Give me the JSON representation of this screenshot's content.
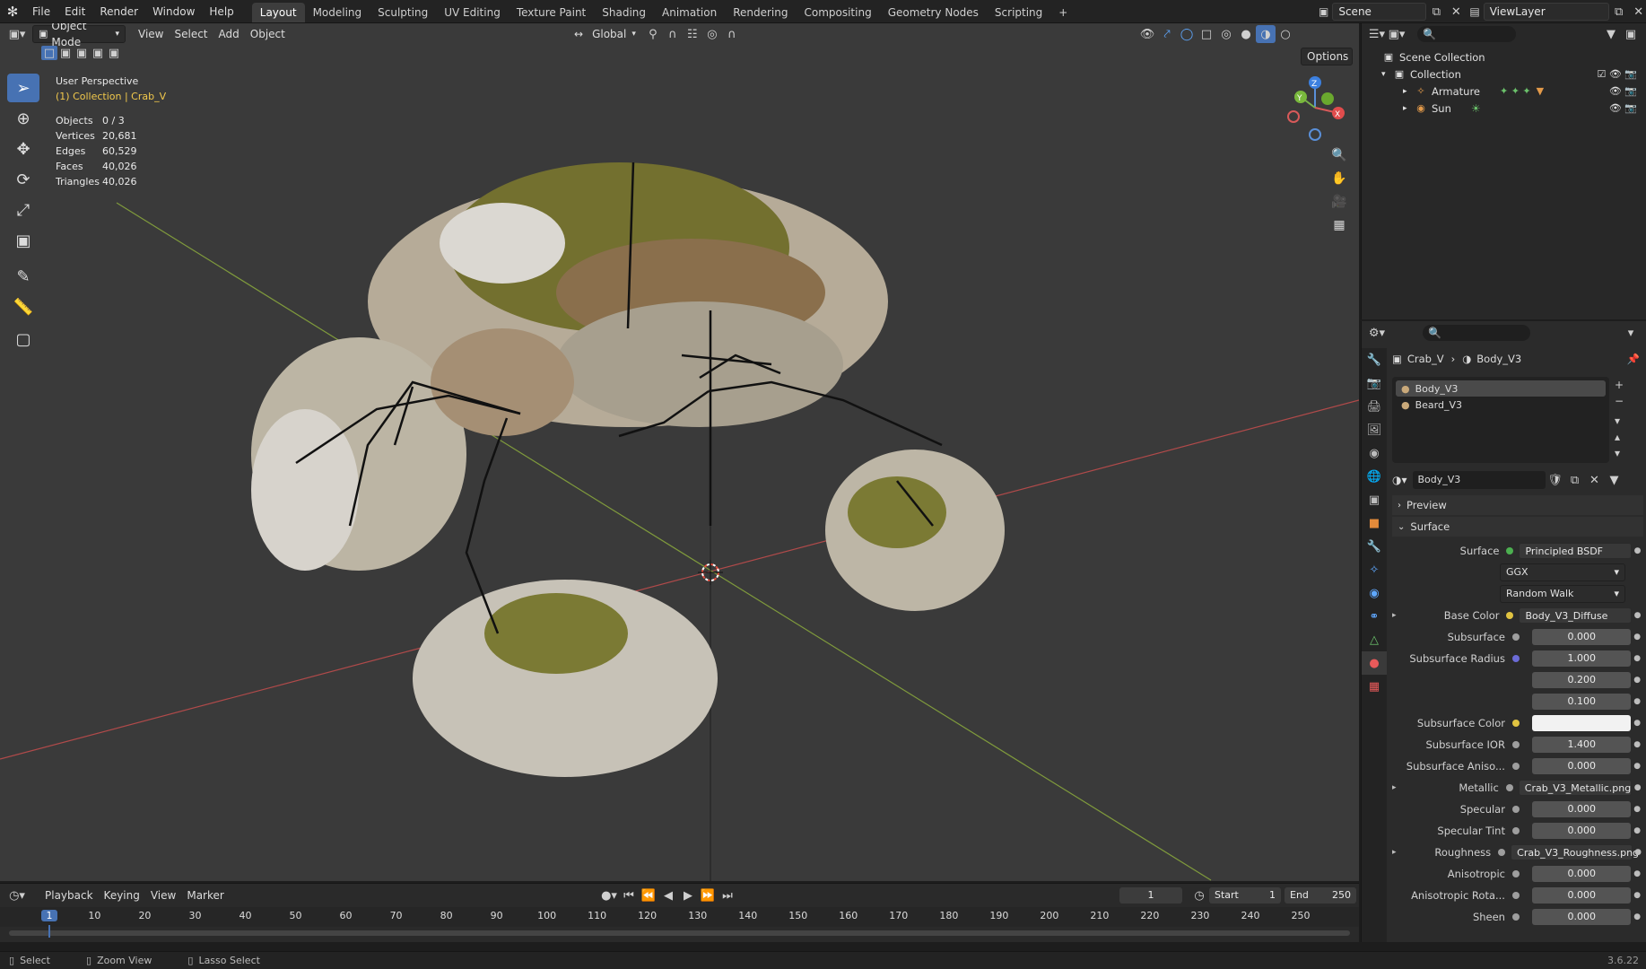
{
  "topbar": {
    "menus": [
      "File",
      "Edit",
      "Render",
      "Window",
      "Help"
    ],
    "workspaces": [
      "Layout",
      "Modeling",
      "Sculpting",
      "UV Editing",
      "Texture Paint",
      "Shading",
      "Animation",
      "Rendering",
      "Compositing",
      "Geometry Nodes",
      "Scripting"
    ],
    "active_workspace": "Layout",
    "add_tab": "+",
    "scene_name": "Scene",
    "view_layer": "ViewLayer"
  },
  "viewport": {
    "mode": "Object Mode",
    "menus": [
      "View",
      "Select",
      "Add",
      "Object"
    ],
    "transform_orientation": "Global",
    "options_label": "Options",
    "perspective": "User Perspective",
    "collection_path": "(1) Collection | Crab_V",
    "stats": [
      {
        "k": "Objects",
        "v": "0 / 3"
      },
      {
        "k": "Vertices",
        "v": "20,681"
      },
      {
        "k": "Edges",
        "v": "60,529"
      },
      {
        "k": "Faces",
        "v": "40,026"
      },
      {
        "k": "Triangles",
        "v": "40,026"
      }
    ],
    "gizmo_axes": {
      "x": "X",
      "y": "Y",
      "z": "Z"
    }
  },
  "outliner": {
    "root": "Scene Collection",
    "collection": "Collection",
    "items": [
      "Armature",
      "Sun"
    ]
  },
  "properties": {
    "breadcrumb": {
      "object": "Crab_V",
      "material": "Body_V3"
    },
    "material_slots": [
      "Body_V3",
      "Beard_V3"
    ],
    "material_name": "Body_V3",
    "preview_label": "Preview",
    "surface_panel": "Surface",
    "surface_shader": "Principled BSDF",
    "distribution": "GGX",
    "subsurface_method": "Random Walk",
    "rows": [
      {
        "label": "Surface",
        "value": "Principled BSDF",
        "kind": "link",
        "socket": "#4caf50",
        "expand": false
      },
      {
        "label": "Base Color",
        "value": "Body_V3_Diffuse",
        "kind": "link",
        "socket": "#e0c341",
        "expand": true
      },
      {
        "label": "Subsurface",
        "value": "0.000",
        "kind": "num",
        "socket": "#9e9e9e",
        "expand": false
      },
      {
        "label": "Subsurface Radius",
        "value": "1.000",
        "kind": "num",
        "socket": "#6b6bd6",
        "expand": false
      },
      {
        "label": "",
        "value": "0.200",
        "kind": "num",
        "socket": "",
        "expand": false
      },
      {
        "label": "",
        "value": "0.100",
        "kind": "num",
        "socket": "",
        "expand": false
      },
      {
        "label": "Subsurface Color",
        "value": "",
        "kind": "color",
        "socket": "#e0c341",
        "expand": false
      },
      {
        "label": "Subsurface IOR",
        "value": "1.400",
        "kind": "num",
        "socket": "#9e9e9e",
        "expand": false
      },
      {
        "label": "Subsurface Aniso...",
        "value": "0.000",
        "kind": "num",
        "socket": "#9e9e9e",
        "expand": false
      },
      {
        "label": "Metallic",
        "value": "Crab_V3_Metallic.png",
        "kind": "link",
        "socket": "#9e9e9e",
        "expand": true
      },
      {
        "label": "Specular",
        "value": "0.000",
        "kind": "num",
        "socket": "#9e9e9e",
        "expand": false
      },
      {
        "label": "Specular Tint",
        "value": "0.000",
        "kind": "num",
        "socket": "#9e9e9e",
        "expand": false
      },
      {
        "label": "Roughness",
        "value": "Crab_V3_Roughness.png",
        "kind": "link",
        "socket": "#9e9e9e",
        "expand": true
      },
      {
        "label": "Anisotropic",
        "value": "0.000",
        "kind": "num",
        "socket": "#9e9e9e",
        "expand": false
      },
      {
        "label": "Anisotropic Rota...",
        "value": "0.000",
        "kind": "num",
        "socket": "#9e9e9e",
        "expand": false
      },
      {
        "label": "Sheen",
        "value": "0.000",
        "kind": "num",
        "socket": "#9e9e9e",
        "expand": false
      }
    ]
  },
  "timeline": {
    "menus": [
      "Playback",
      "Keying",
      "View",
      "Marker"
    ],
    "current_frame": "1",
    "start_label": "Start",
    "start": "1",
    "end_label": "End",
    "end": "250",
    "ruler": [
      "1",
      "10",
      "20",
      "30",
      "40",
      "50",
      "60",
      "70",
      "80",
      "90",
      "100",
      "110",
      "120",
      "130",
      "140",
      "150",
      "160",
      "170",
      "180",
      "190",
      "200",
      "210",
      "220",
      "230",
      "240",
      "250"
    ]
  },
  "status": {
    "items": [
      "Select",
      "Zoom View",
      "Lasso Select"
    ],
    "version": "3.6.22"
  }
}
